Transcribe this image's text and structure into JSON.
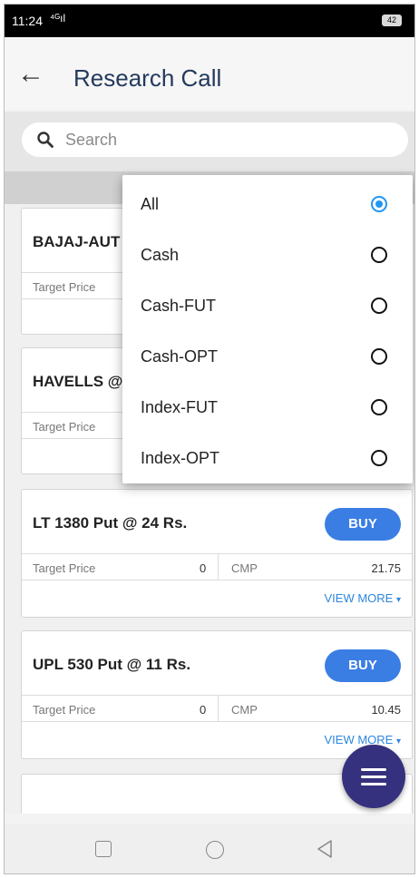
{
  "status_bar": {
    "time": "11:24",
    "signal": "⁴ᴳıl",
    "battery": "42"
  },
  "header": {
    "back_icon": "arrow-left-icon",
    "title": "Research Call"
  },
  "search": {
    "placeholder": "Search",
    "icon": "search-icon"
  },
  "filter_menu": {
    "options": [
      {
        "label": "All",
        "selected": true
      },
      {
        "label": "Cash",
        "selected": false
      },
      {
        "label": "Cash-FUT",
        "selected": false
      },
      {
        "label": "Cash-OPT",
        "selected": false
      },
      {
        "label": "Index-FUT",
        "selected": false
      },
      {
        "label": "Index-OPT",
        "selected": false
      }
    ],
    "accent": "#2196f3"
  },
  "calls": [
    {
      "name": "BAJAJ-AUT",
      "target_label": "Target Price"
    },
    {
      "name": "HAVELLS @",
      "target_label": "Target Price"
    },
    {
      "name": "LT 1380 Put @ 24 Rs.",
      "action": "BUY",
      "target_label": "Target Price",
      "target_value": "0",
      "cmp_label": "CMP",
      "cmp_value": "21.75",
      "more": "VIEW MORE",
      "caret": "▾"
    },
    {
      "name": "UPL 530 Put @ 11 Rs.",
      "action": "BUY",
      "target_label": "Target Price",
      "target_value": "0",
      "cmp_label": "CMP",
      "cmp_value": "10.45",
      "more": "VIEW MORE",
      "caret": "▾"
    }
  ],
  "colors": {
    "buy": "#3a7ee4",
    "fab": "#35317e",
    "title": "#243a5e",
    "link": "#2e86de"
  },
  "fab": {
    "icon": "menu-icon"
  },
  "nav_bar": {
    "icons": [
      "recent-apps-icon",
      "home-icon",
      "back-triangle-icon"
    ]
  }
}
